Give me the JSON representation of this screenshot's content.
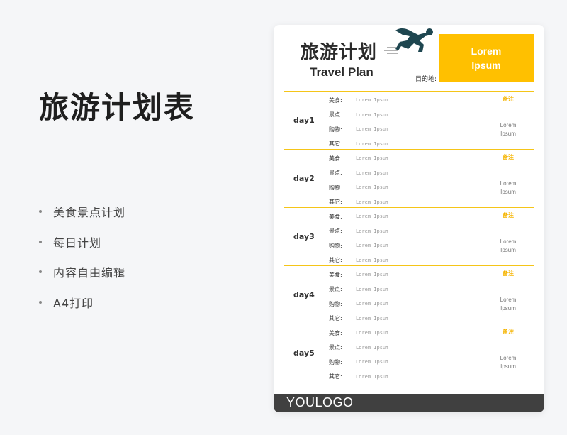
{
  "page": {
    "title": "旅游计划表",
    "features": [
      "美食景点计划",
      "每日计划",
      "内容自由编辑",
      "A4打印"
    ]
  },
  "document": {
    "title_cn": "旅游计划",
    "title_en": "Travel Plan",
    "destination_label": "目的地:",
    "highlight_text": "Lorem Ipsum",
    "accent_color": "#ffc000",
    "icon": "running-man-icon",
    "days": [
      {
        "label": "day1",
        "items": [
          {
            "label": "美食:",
            "value": "Lorem Ipsum"
          },
          {
            "label": "景点:",
            "value": "Lorem Ipsum"
          },
          {
            "label": "购物:",
            "value": "Lorem Ipsum"
          },
          {
            "label": "其它:",
            "value": "Lorem Ipsum"
          }
        ],
        "note_title": "备注",
        "note": "Lorem Ipsum"
      },
      {
        "label": "day2",
        "items": [
          {
            "label": "美食:",
            "value": "Lorem Ipsum"
          },
          {
            "label": "景点:",
            "value": "Lorem Ipsum"
          },
          {
            "label": "购物:",
            "value": "Lorem Ipsum"
          },
          {
            "label": "其它:",
            "value": "Lorem Ipsum"
          }
        ],
        "note_title": "备注",
        "note": "Lorem Ipsum"
      },
      {
        "label": "day3",
        "items": [
          {
            "label": "美食:",
            "value": "Lorem Ipsum"
          },
          {
            "label": "景点:",
            "value": "Lorem Ipsum"
          },
          {
            "label": "购物:",
            "value": "Lorem Ipsum"
          },
          {
            "label": "其它:",
            "value": "Lorem Ipsum"
          }
        ],
        "note_title": "备注",
        "note": "Lorem Ipsum"
      },
      {
        "label": "day4",
        "items": [
          {
            "label": "美食:",
            "value": "Lorem Ipsum"
          },
          {
            "label": "景点:",
            "value": "Lorem Ipsum"
          },
          {
            "label": "购物:",
            "value": "Lorem Ipsum"
          },
          {
            "label": "其它:",
            "value": "Lorem Ipsum"
          }
        ],
        "note_title": "备注",
        "note": "Lorem Ipsum"
      },
      {
        "label": "day5",
        "items": [
          {
            "label": "美食:",
            "value": "Lorem Ipsum"
          },
          {
            "label": "景点:",
            "value": "Lorem Ipsum"
          },
          {
            "label": "购物:",
            "value": "Lorem Ipsum"
          },
          {
            "label": "其它:",
            "value": "Lorem Ipsum"
          }
        ],
        "note_title": "备注",
        "note": "Lorem Ipsum"
      }
    ],
    "footer_logo": "YOULOGO"
  }
}
